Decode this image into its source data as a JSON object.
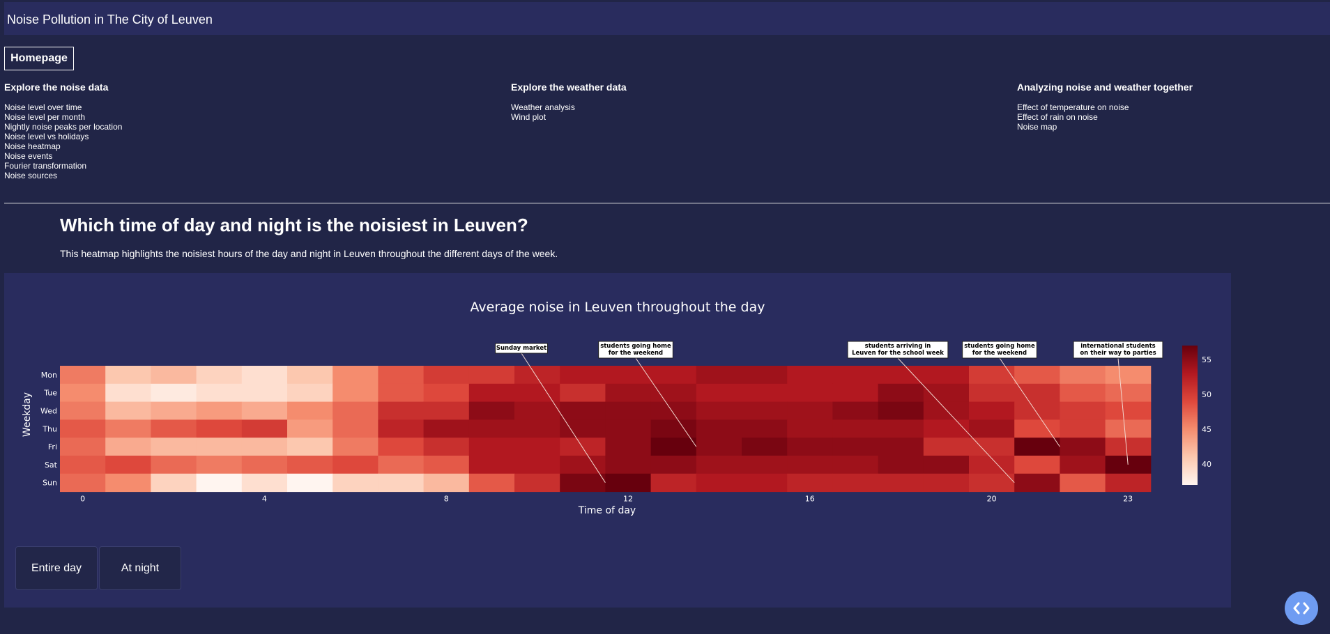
{
  "app": {
    "title": "Noise Pollution in The City of Leuven"
  },
  "nav": {
    "home_label": "Homepage",
    "columns": [
      {
        "heading": "Explore the noise data",
        "links": [
          "Noise level over time",
          "Noise level per month",
          "Nightly noise peaks per location",
          "Noise level vs holidays",
          "Noise heatmap",
          "Noise events",
          "Fourier transformation",
          "Noise sources"
        ]
      },
      {
        "heading": "Explore the weather data",
        "links": [
          "Weather analysis",
          "Wind plot"
        ]
      },
      {
        "heading": "Analyzing noise and weather together",
        "links": [
          "Effect of temperature on noise",
          "Effect of rain on noise",
          "Noise map"
        ]
      }
    ]
  },
  "section": {
    "heading": "Which time of day and night is the noisiest in Leuven?",
    "description": "This heatmap highlights the noisiest hours of the day and night in Leuven throughout the different days of the week."
  },
  "buttons": {
    "entire_day": "Entire day",
    "at_night": "At night"
  },
  "colors": {
    "background": "#212547",
    "panel": "#292c5e",
    "accent": "#6f9cf2"
  },
  "icons": {
    "code_toggle": "code-brackets-icon"
  },
  "chart_data": {
    "type": "heatmap",
    "title": "Average noise in Leuven throughout the day",
    "xlabel": "Time of day",
    "ylabel": "Weekday",
    "x_ticks": [
      "0",
      "4",
      "8",
      "12",
      "16",
      "20",
      "23"
    ],
    "x": [
      0,
      1,
      2,
      3,
      4,
      5,
      6,
      7,
      8,
      9,
      10,
      11,
      12,
      13,
      14,
      15,
      16,
      17,
      18,
      19,
      20,
      21,
      22,
      23
    ],
    "y": [
      "Mon",
      "Tue",
      "Wed",
      "Thu",
      "Fri",
      "Sat",
      "Sun"
    ],
    "colorbar_ticks": [
      "55",
      "50",
      "45",
      "40"
    ],
    "zlim": [
      37,
      57
    ],
    "z": [
      [
        46,
        41,
        42,
        40,
        39,
        41,
        45,
        48,
        50,
        50,
        52,
        53,
        53,
        53,
        54,
        54,
        53,
        53,
        53,
        53,
        50,
        48,
        46,
        45
      ],
      [
        45,
        39,
        38,
        39,
        39,
        40,
        45,
        48,
        49,
        53,
        53,
        51,
        54,
        54,
        53,
        53,
        53,
        53,
        55,
        54,
        51,
        51,
        48,
        47
      ],
      [
        46,
        42,
        43,
        44,
        43,
        45,
        47,
        51,
        51,
        55,
        54,
        55,
        55,
        55,
        54,
        54,
        54,
        55,
        56,
        54,
        53,
        51,
        50,
        49
      ],
      [
        48,
        46,
        48,
        49,
        50,
        44,
        47,
        52,
        54,
        54,
        54,
        55,
        55,
        56,
        55,
        55,
        54,
        54,
        54,
        53,
        54,
        49,
        50,
        47
      ],
      [
        47,
        43,
        42,
        42,
        42,
        41,
        46,
        49,
        51,
        53,
        53,
        52,
        55,
        58,
        55,
        56,
        55,
        55,
        55,
        51,
        51,
        58,
        55,
        51
      ],
      [
        48,
        49,
        47,
        46,
        47,
        48,
        49,
        47,
        48,
        53,
        53,
        54,
        55,
        55,
        54,
        54,
        54,
        54,
        55,
        55,
        52,
        49,
        54,
        57
      ],
      [
        47,
        45,
        40,
        37,
        39,
        37,
        40,
        40,
        42,
        48,
        51,
        56,
        58,
        52,
        53,
        53,
        52,
        52,
        52,
        52,
        51,
        55,
        48,
        52
      ]
    ],
    "annotations": [
      {
        "text": [
          "Sunday market"
        ],
        "x": 11.5,
        "y": "Sun"
      },
      {
        "text": [
          "students going home",
          "for the weekend"
        ],
        "x": 13.5,
        "y": "Fri"
      },
      {
        "text": [
          "students arriving in",
          "Leuven for the school week"
        ],
        "x": 20.5,
        "y": "Sun"
      },
      {
        "text": [
          "students going home",
          "for the weekend"
        ],
        "x": 21.5,
        "y": "Fri"
      },
      {
        "text": [
          "international students",
          "on their way to parties"
        ],
        "x": 23,
        "y": "Sat"
      }
    ]
  }
}
